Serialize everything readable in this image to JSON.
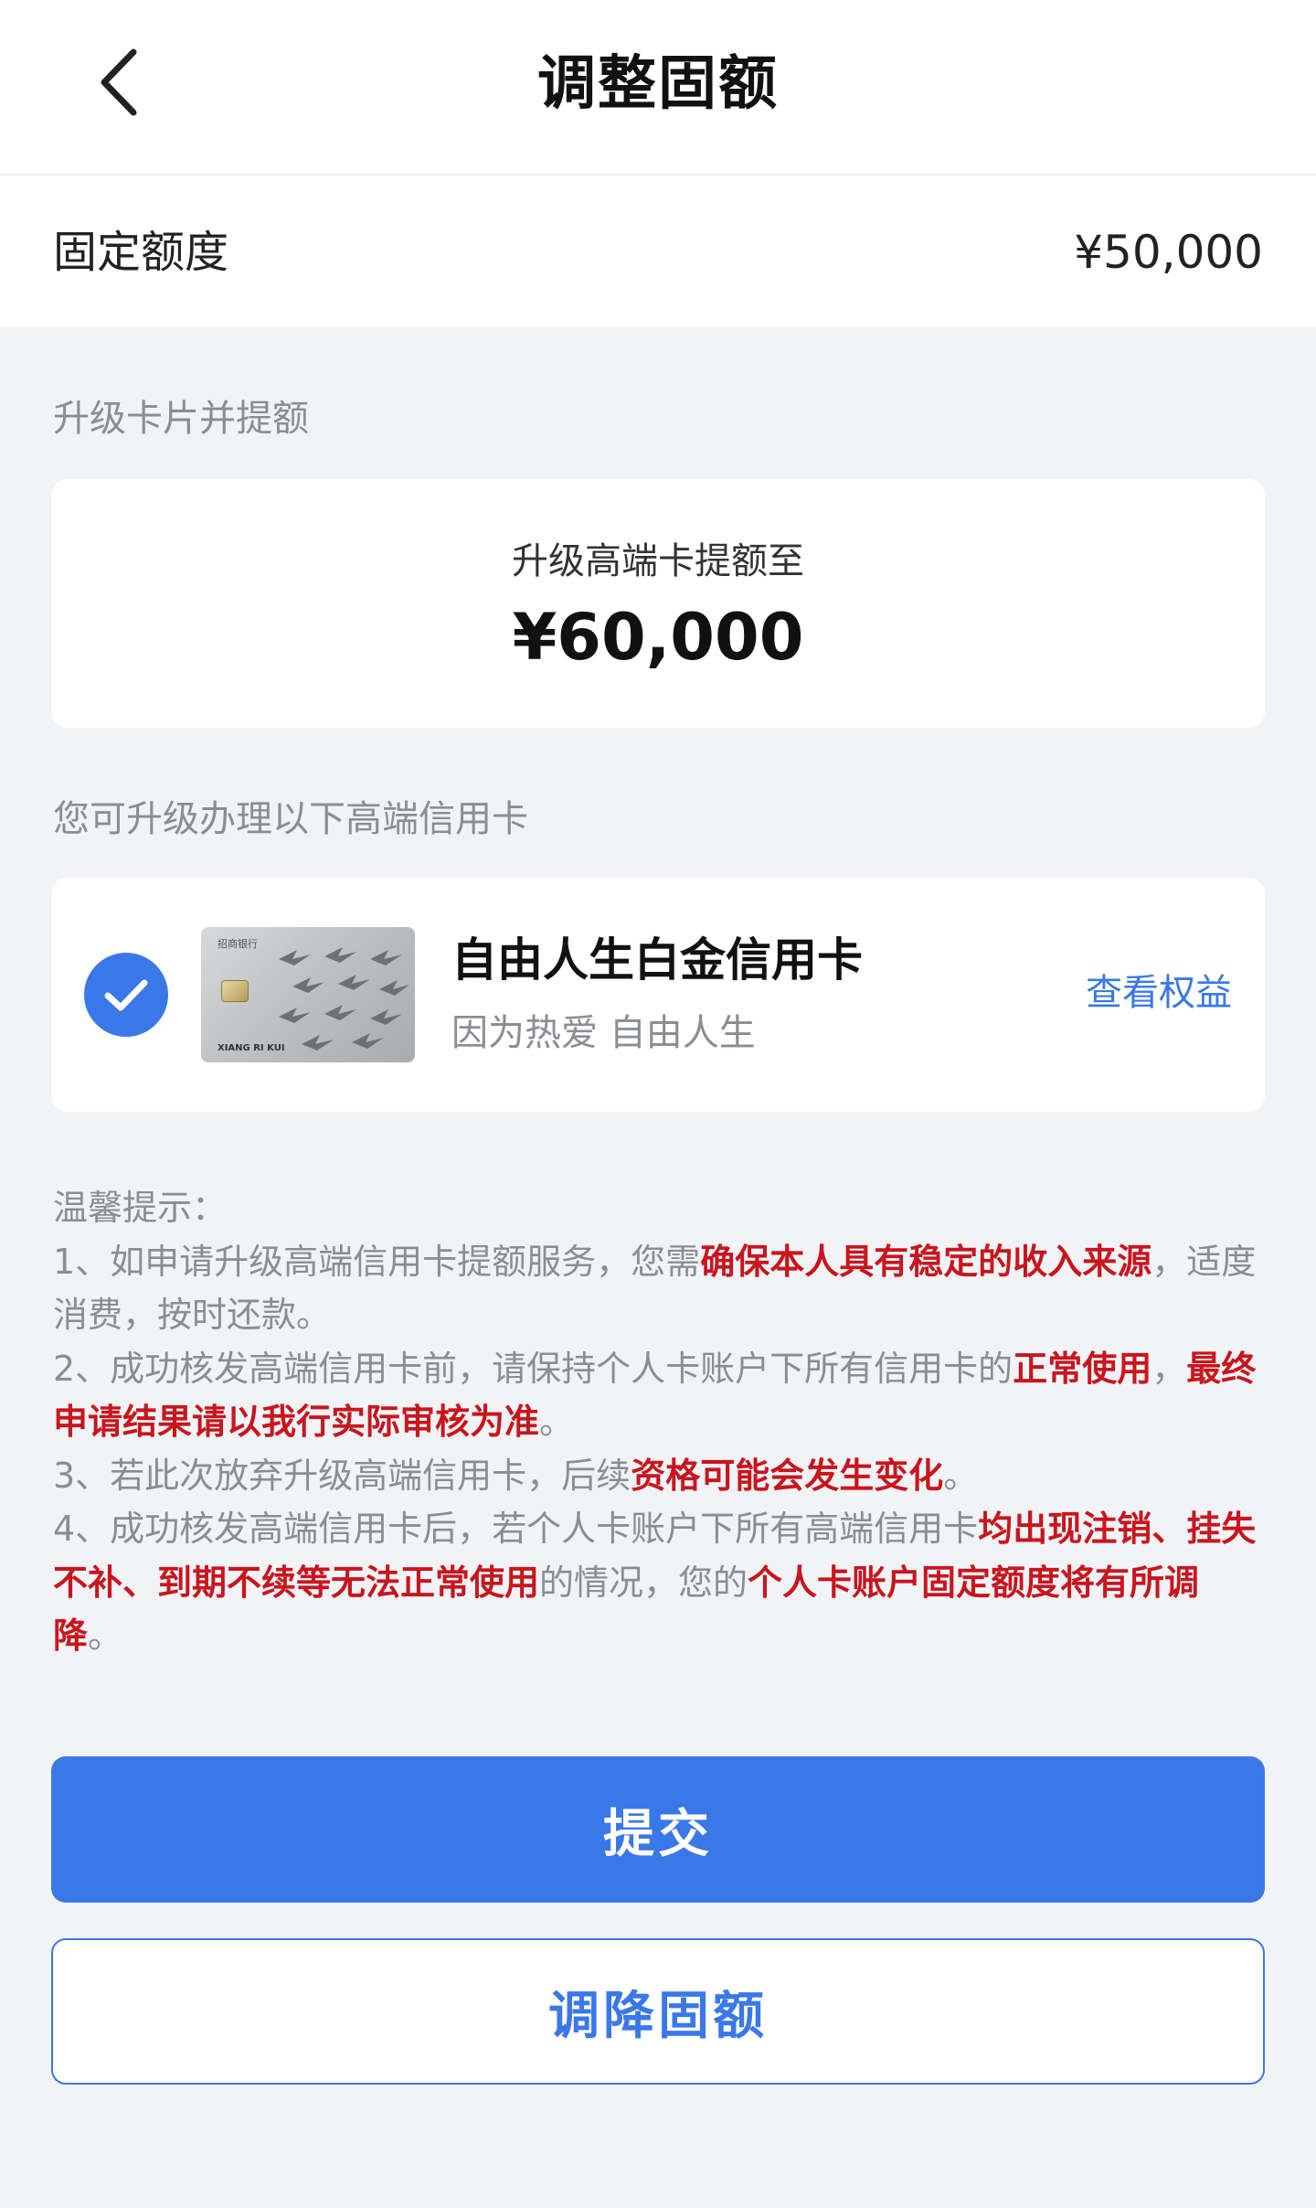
{
  "header": {
    "title": "调整固额"
  },
  "fixed_limit": {
    "label": "固定额度",
    "value": "¥50,000"
  },
  "upgrade_section": {
    "heading": "升级卡片并提额",
    "caption": "升级高端卡提额至",
    "amount": "¥60,000"
  },
  "cards_section": {
    "heading": "您可升级办理以下高端信用卡",
    "card": {
      "name": "自由人生白金信用卡",
      "slogan": "因为热爱 自由人生",
      "benefits_link": "查看权益",
      "selected": true,
      "thumbnail": {
        "bank_text": "招商银行",
        "holder_text": "XIANG RI KUI"
      }
    }
  },
  "tips": {
    "title": "温馨提示：",
    "t1a": "1、如申请升级高端信用卡提额服务，您需",
    "t1b": "确保本人具有稳定的收入来源",
    "t1c": "，适度消费，按时还款。",
    "t2a": "2、成功核发高端信用卡前，请保持个人卡账户下所有信用卡的",
    "t2b": "正常使用",
    "t2c": "，",
    "t2d": "最终申请结果请以我行实际审核为准",
    "t2e": "。",
    "t3a": "3、若此次放弃升级高端信用卡，后续",
    "t3b": "资格可能会发生变化",
    "t3c": "。",
    "t4a": "4、成功核发高端信用卡后，若个人卡账户下所有高端信用卡",
    "t4b": "均出现注销、挂失不补、到期不续等无法正常使用",
    "t4c": "的情况，您的",
    "t4d": "个人卡账户固定额度将有所调降",
    "t4e": "。"
  },
  "buttons": {
    "submit": "提交",
    "decrease": "调降固额"
  },
  "colors": {
    "primary": "#3a78e8",
    "warning_red": "#c8161d",
    "muted_text": "#8a8d94"
  }
}
